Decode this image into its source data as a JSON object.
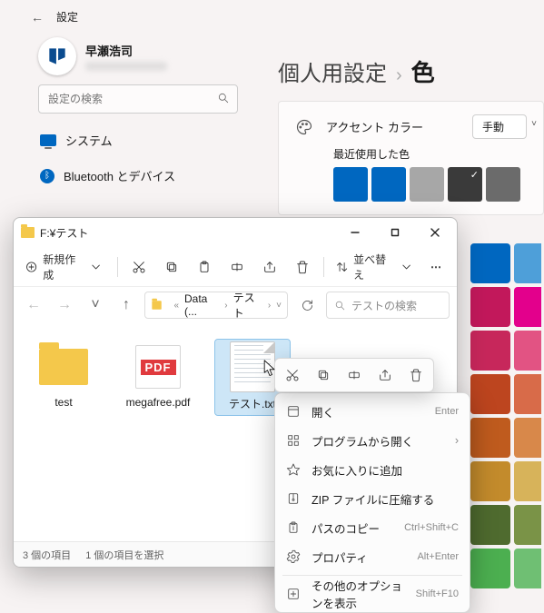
{
  "settings": {
    "app_title": "設定",
    "profile_name": "早瀬浩司",
    "search_placeholder": "設定の検索",
    "nav": {
      "system": "システム",
      "bluetooth": "Bluetooth とデバイス"
    },
    "breadcrumb": {
      "root": "個人用設定",
      "leaf": "色"
    },
    "accent": {
      "label": "アクセント カラー",
      "mode": "手動",
      "recent_label": "最近使用した色",
      "recent": [
        {
          "hex": "#0067c0",
          "check": false
        },
        {
          "hex": "#0067c0",
          "check": false
        },
        {
          "hex": "#a7a7a7",
          "check": false
        },
        {
          "hex": "#3a3a3a",
          "check": true
        },
        {
          "hex": "#6b6b6b",
          "check": false
        }
      ]
    },
    "grid_cols": [
      [
        "#0067c0",
        "#c2185b",
        "#c7275b",
        "#bd451f",
        "#bf5b1e",
        "#c38b2c",
        "#4f6b2f",
        "#4caf50"
      ],
      [
        "#4e9fd9",
        "#e3008c",
        "#e25383",
        "#d86b49",
        "#d8884a",
        "#d7b35a",
        "#7a9347",
        "#6fbf73"
      ]
    ]
  },
  "explorer": {
    "title": "F:¥テスト",
    "toolbar": {
      "new": "新規作成",
      "sort": "並べ替え"
    },
    "breadcrumb": {
      "a": "Data (...",
      "b": "テスト"
    },
    "search_placeholder": "テストの検索",
    "files": [
      {
        "name": "test",
        "kind": "folder"
      },
      {
        "name": "megafree.pdf",
        "kind": "pdf"
      },
      {
        "name": "テスト.txt",
        "kind": "txt",
        "selected": true
      }
    ],
    "status": {
      "count": "3 個の項目",
      "sel": "1 個の項目を選択"
    }
  },
  "context": {
    "items": [
      {
        "icon": "open",
        "label": "開く",
        "accel": "Enter",
        "submenu": false
      },
      {
        "icon": "apps",
        "label": "プログラムから開く",
        "accel": "",
        "submenu": true
      },
      {
        "icon": "star",
        "label": "お気に入りに追加",
        "accel": "",
        "submenu": false
      },
      {
        "icon": "zip",
        "label": "ZIP ファイルに圧縮する",
        "accel": "",
        "submenu": false
      },
      {
        "icon": "path",
        "label": "パスのコピー",
        "accel": "Ctrl+Shift+C",
        "submenu": false
      },
      {
        "icon": "props",
        "label": "プロパティ",
        "accel": "Alt+Enter",
        "submenu": false
      }
    ],
    "more": {
      "label": "その他のオプションを表示",
      "accel": "Shift+F10"
    }
  }
}
